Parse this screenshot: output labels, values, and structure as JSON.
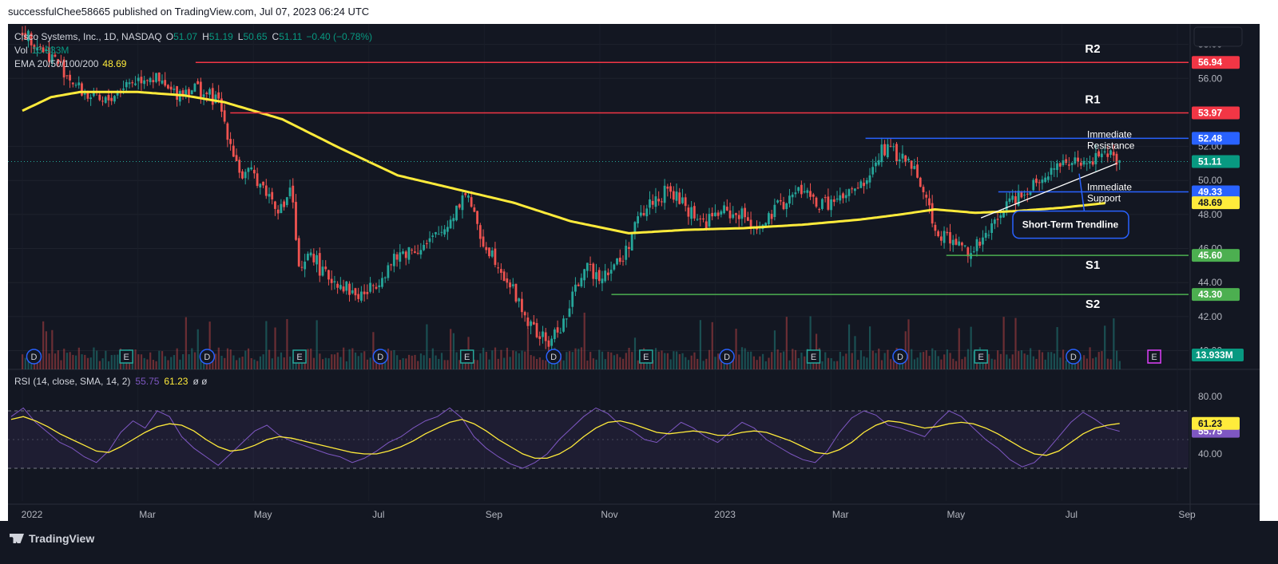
{
  "header": {
    "publisher_line": "successfulChee58665 published on TradingView.com, Jul 07, 2023 06:24 UTC"
  },
  "legend": {
    "symbol": "Cisco Systems, Inc., 1D, NASDAQ",
    "ohlc": [
      {
        "k": "O",
        "v": "51.07"
      },
      {
        "k": "H",
        "v": "51.19"
      },
      {
        "k": "L",
        "v": "50.65"
      },
      {
        "k": "C",
        "v": "51.11"
      }
    ],
    "change": "−0.40 (−0.78%)",
    "vol_label": "Vol",
    "vol_value": "13.933M",
    "ema_label": "EMA 20/50/100/200",
    "ema_value": "48.69"
  },
  "rsi_legend": {
    "label": "RSI (14, close, SMA, 14, 2)",
    "rsi_value": "55.75",
    "sma_value": "61.23",
    "extra": "ø  ø"
  },
  "footer": {
    "brand": "TradingView"
  },
  "colors": {
    "bg": "#131722",
    "up": "#26a69a",
    "down": "#ef5350",
    "resistance": "#f23645",
    "support_blue": "#2962ff",
    "support_green": "#4caf50",
    "ema": "#ffeb3b",
    "rsi": "#7e57c2",
    "rsi_sma": "#ffeb3b"
  },
  "chart_data": [
    {
      "type": "candlestick",
      "title": "Cisco Systems, Inc., 1D, NASDAQ",
      "x_ticks": [
        "2022",
        "Mar",
        "May",
        "Jul",
        "Sep",
        "Nov",
        "2023",
        "Mar",
        "May",
        "Jul",
        "Sep"
      ],
      "y_ticks": [
        40.0,
        42.0,
        44.0,
        46.0,
        48.0,
        50.0,
        52.0,
        56.0,
        58.0
      ],
      "ylim": [
        38.9,
        59.2
      ],
      "close_path": [
        {
          "t": 0,
          "v": 58.8
        },
        {
          "t": 0.3,
          "v": 57.9
        },
        {
          "t": 0.6,
          "v": 57.0
        },
        {
          "t": 1.0,
          "v": 55.3
        },
        {
          "t": 1.4,
          "v": 54.5
        },
        {
          "t": 1.8,
          "v": 55.7
        },
        {
          "t": 2.2,
          "v": 56.2
        },
        {
          "t": 2.6,
          "v": 55.1
        },
        {
          "t": 3.0,
          "v": 55.5
        },
        {
          "t": 3.4,
          "v": 54.6
        },
        {
          "t": 3.6,
          "v": 52.3
        },
        {
          "t": 3.8,
          "v": 50.2
        },
        {
          "t": 4.0,
          "v": 50.4
        },
        {
          "t": 4.3,
          "v": 49.0
        },
        {
          "t": 4.5,
          "v": 48.2
        },
        {
          "t": 4.65,
          "v": 49.8
        },
        {
          "t": 4.8,
          "v": 44.2
        },
        {
          "t": 5.0,
          "v": 45.9
        },
        {
          "t": 5.2,
          "v": 44.5
        },
        {
          "t": 5.5,
          "v": 44.0
        },
        {
          "t": 5.8,
          "v": 43.2
        },
        {
          "t": 6.0,
          "v": 43.5
        },
        {
          "t": 6.3,
          "v": 44.8
        },
        {
          "t": 6.6,
          "v": 45.8
        },
        {
          "t": 7.0,
          "v": 46.2
        },
        {
          "t": 7.3,
          "v": 47.1
        },
        {
          "t": 7.5,
          "v": 48.3
        },
        {
          "t": 7.7,
          "v": 49.5
        },
        {
          "t": 7.9,
          "v": 46.8
        },
        {
          "t": 8.2,
          "v": 45.4
        },
        {
          "t": 8.5,
          "v": 43.5
        },
        {
          "t": 8.8,
          "v": 41.4
        },
        {
          "t": 9.1,
          "v": 40.4
        },
        {
          "t": 9.4,
          "v": 41.8
        },
        {
          "t": 9.7,
          "v": 44.8
        },
        {
          "t": 10.0,
          "v": 44.5
        },
        {
          "t": 10.2,
          "v": 44.9
        },
        {
          "t": 10.4,
          "v": 45.4
        },
        {
          "t": 10.6,
          "v": 47.3
        },
        {
          "t": 10.9,
          "v": 48.8
        },
        {
          "t": 11.2,
          "v": 49.4
        },
        {
          "t": 11.5,
          "v": 48.4
        },
        {
          "t": 11.8,
          "v": 47.5
        },
        {
          "t": 12.1,
          "v": 48.2
        },
        {
          "t": 12.5,
          "v": 47.9
        },
        {
          "t": 12.8,
          "v": 47.1
        },
        {
          "t": 13.1,
          "v": 48.5
        },
        {
          "t": 13.5,
          "v": 49.5
        },
        {
          "t": 13.8,
          "v": 48.5
        },
        {
          "t": 14.2,
          "v": 48.9
        },
        {
          "t": 14.6,
          "v": 49.8
        },
        {
          "t": 14.9,
          "v": 51.9
        },
        {
          "t": 15.2,
          "v": 51.4
        },
        {
          "t": 15.5,
          "v": 50.6
        },
        {
          "t": 15.8,
          "v": 47.2
        },
        {
          "t": 16.1,
          "v": 46.4
        },
        {
          "t": 16.4,
          "v": 45.9
        },
        {
          "t": 16.7,
          "v": 46.6
        },
        {
          "t": 17.0,
          "v": 48.5
        },
        {
          "t": 17.4,
          "v": 49.6
        },
        {
          "t": 17.8,
          "v": 50.6
        },
        {
          "t": 18.1,
          "v": 51.2
        },
        {
          "t": 18.4,
          "v": 50.7
        },
        {
          "t": 18.7,
          "v": 51.8
        },
        {
          "t": 19.0,
          "v": 51.0
        }
      ],
      "ema200_path": [
        {
          "t": 0,
          "v": 54.1
        },
        {
          "t": 0.5,
          "v": 54.9
        },
        {
          "t": 1,
          "v": 55.2
        },
        {
          "t": 2,
          "v": 55.2
        },
        {
          "t": 2.8,
          "v": 55.0
        },
        {
          "t": 3.5,
          "v": 54.6
        },
        {
          "t": 4.5,
          "v": 53.6
        },
        {
          "t": 5.5,
          "v": 51.9
        },
        {
          "t": 6.5,
          "v": 50.3
        },
        {
          "t": 7.5,
          "v": 49.5
        },
        {
          "t": 8.5,
          "v": 48.7
        },
        {
          "t": 9.5,
          "v": 47.6
        },
        {
          "t": 10.5,
          "v": 46.9
        },
        {
          "t": 11.5,
          "v": 47.1
        },
        {
          "t": 12.5,
          "v": 47.2
        },
        {
          "t": 13.5,
          "v": 47.4
        },
        {
          "t": 14.5,
          "v": 47.7
        },
        {
          "t": 15.2,
          "v": 48.0
        },
        {
          "t": 15.8,
          "v": 48.3
        },
        {
          "t": 16.5,
          "v": 48.1
        },
        {
          "t": 17.2,
          "v": 48.2
        },
        {
          "t": 18.0,
          "v": 48.4
        },
        {
          "t": 18.8,
          "v": 48.69
        }
      ],
      "levels": [
        {
          "name": "R2",
          "value": 56.94,
          "label": "56.94",
          "color": "#f23645",
          "from_t": 3.0
        },
        {
          "name": "R1",
          "value": 53.97,
          "label": "53.97",
          "color": "#f23645",
          "from_t": 3.6
        },
        {
          "name": "",
          "value": 52.48,
          "label": "52.48",
          "color": "#2962ff",
          "from_t": 14.6
        },
        {
          "name": "",
          "value": 49.33,
          "label": "49.33",
          "color": "#2962ff",
          "from_t": 16.9
        },
        {
          "name": "S1",
          "value": 45.6,
          "label": "45.60",
          "color": "#4caf50",
          "from_t": 16.0
        },
        {
          "name": "S2",
          "value": 43.3,
          "label": "43.30",
          "color": "#4caf50",
          "from_t": 10.2
        }
      ],
      "current_price": {
        "value": 51.11,
        "label": "51.11"
      },
      "ema_tag": {
        "value": 48.69,
        "label": "48.69"
      },
      "volume_tag": "13.933M",
      "annotations": {
        "immediate_resistance": [
          "Immediate",
          "Resistance"
        ],
        "immediate_support": [
          "Immediate",
          "Support"
        ],
        "trendline_box": "Short-Term Trendline"
      },
      "event_markers": [
        {
          "t": 0.2,
          "mark": "D"
        },
        {
          "t": 1.8,
          "mark": "E"
        },
        {
          "t": 3.2,
          "mark": "D"
        },
        {
          "t": 4.8,
          "mark": "E"
        },
        {
          "t": 6.2,
          "mark": "D"
        },
        {
          "t": 7.7,
          "mark": "E"
        },
        {
          "t": 9.2,
          "mark": "D"
        },
        {
          "t": 10.8,
          "mark": "E"
        },
        {
          "t": 12.2,
          "mark": "D"
        },
        {
          "t": 13.7,
          "mark": "E"
        },
        {
          "t": 15.2,
          "mark": "D"
        },
        {
          "t": 16.6,
          "mark": "E"
        },
        {
          "t": 18.2,
          "mark": "D"
        },
        {
          "t": 19.6,
          "mark": "E"
        }
      ]
    },
    {
      "type": "line",
      "title": "RSI (14, close, SMA, 14, 2)",
      "y_ticks": [
        40.0,
        80.0
      ],
      "bands": [
        70,
        30
      ],
      "series": [
        {
          "name": "RSI",
          "color": "#7e57c2",
          "last": 55.75,
          "values": [
            66,
            72,
            62,
            55,
            48,
            44,
            38,
            34,
            42,
            55,
            63,
            58,
            70,
            66,
            52,
            44,
            38,
            32,
            40,
            48,
            56,
            60,
            53,
            49,
            46,
            43,
            40,
            38,
            34,
            37,
            42,
            48,
            52,
            58,
            63,
            66,
            72,
            65,
            52,
            44,
            38,
            33,
            30,
            34,
            40,
            50,
            58,
            66,
            72,
            68,
            60,
            56,
            50,
            48,
            55,
            62,
            58,
            52,
            48,
            55,
            62,
            58,
            50,
            45,
            40,
            36,
            34,
            42,
            55,
            65,
            70,
            67,
            60,
            58,
            55,
            52,
            62,
            70,
            66,
            58,
            50,
            44,
            36,
            31,
            34,
            42,
            52,
            62,
            69,
            64,
            58,
            55.75
          ]
        },
        {
          "name": "SMA",
          "color": "#ffeb3b",
          "last": 61.23,
          "values": [
            64,
            66,
            63,
            59,
            54,
            50,
            46,
            42,
            41,
            45,
            50,
            55,
            59,
            61,
            60,
            56,
            50,
            45,
            42,
            43,
            46,
            50,
            52,
            51,
            49,
            47,
            45,
            43,
            41,
            40,
            40,
            42,
            45,
            49,
            54,
            58,
            62,
            64,
            61,
            56,
            50,
            45,
            40,
            37,
            37,
            40,
            45,
            52,
            58,
            62,
            63,
            61,
            58,
            55,
            54,
            55,
            56,
            55,
            53,
            53,
            55,
            56,
            55,
            52,
            49,
            45,
            41,
            40,
            43,
            48,
            55,
            60,
            63,
            62,
            60,
            58,
            59,
            61,
            62,
            61,
            58,
            54,
            49,
            44,
            40,
            39,
            42,
            48,
            54,
            58,
            60,
            61.23
          ]
        }
      ]
    }
  ]
}
